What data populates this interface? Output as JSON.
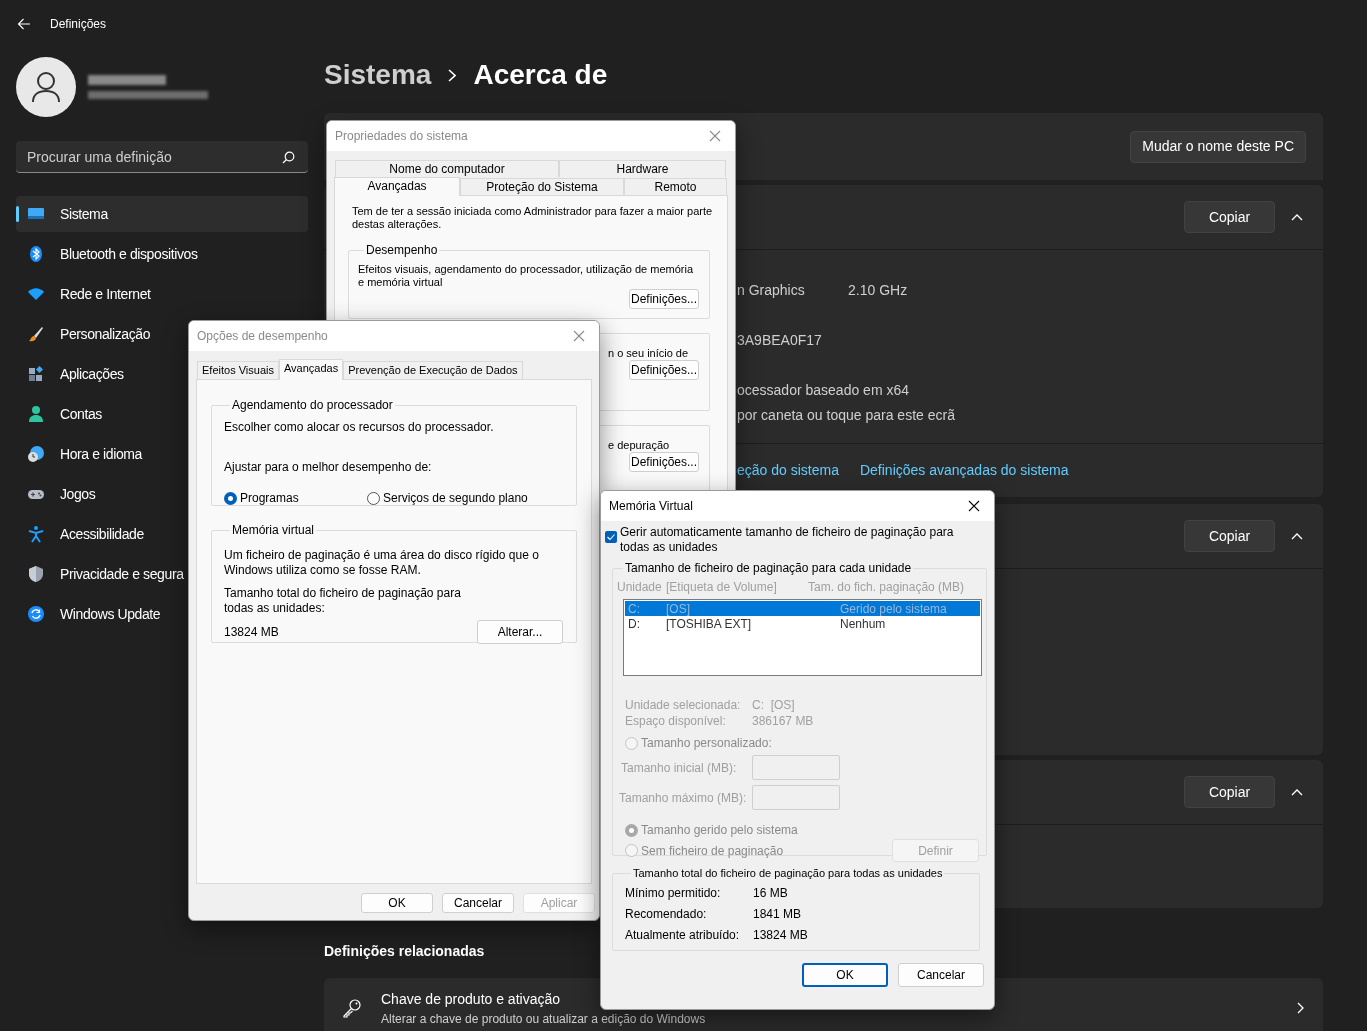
{
  "window": {
    "title": "Definições"
  },
  "sidebar": {
    "search": {
      "placeholder": "Procurar uma definição"
    },
    "items": [
      {
        "label": "Sistema",
        "selected": true
      },
      {
        "label": "Bluetooth e dispositivos",
        "selected": false
      },
      {
        "label": "Rede e Internet",
        "selected": false
      },
      {
        "label": "Personalização",
        "selected": false
      },
      {
        "label": "Aplicações",
        "selected": false
      },
      {
        "label": "Contas",
        "selected": false
      },
      {
        "label": "Hora e idioma",
        "selected": false
      },
      {
        "label": "Jogos",
        "selected": false
      },
      {
        "label": "Acessibilidade",
        "selected": false
      },
      {
        "label": "Privacidade e segura",
        "selected": false
      },
      {
        "label": "Windows Update",
        "selected": false
      }
    ]
  },
  "breadcrumb": {
    "parent": "Sistema",
    "current": "Acerca de"
  },
  "device_card": {
    "button": "Mudar o nome deste PC"
  },
  "specs_card": {
    "button": "Copiar",
    "expanded": true,
    "sections": [
      {
        "lines": [
          [
            "n Graphics",
            "2.10 GHz"
          ]
        ]
      },
      {
        "lines": [
          [
            "3A9BEA0F17"
          ]
        ]
      },
      {
        "lines": [
          [
            "ocessador baseado em x64"
          ],
          [
            "por caneta ou toque para este ecrã"
          ]
        ]
      }
    ],
    "links": [
      "eção do sistema",
      "Definições avançadas do sistema"
    ]
  },
  "windows_card": {
    "button": "Copiar",
    "expanded": true
  },
  "support_card": {
    "button": "Copiar",
    "expanded": true
  },
  "related": {
    "title": "Definições relacionadas",
    "items": [
      {
        "title": "Chave de produto e ativação",
        "subtitle": "Alterar a chave de produto ou atualizar a edição do Windows"
      }
    ]
  },
  "system_properties": {
    "title": "Propriedades do sistema",
    "tab_rows": [
      [
        {
          "label": "Nome do computador",
          "selected": false
        },
        {
          "label": "Hardware",
          "selected": false
        }
      ],
      [
        {
          "label": "Avançadas",
          "selected": true
        },
        {
          "label": "Proteção do Sistema",
          "selected": false
        },
        {
          "label": "Remoto",
          "selected": false
        }
      ]
    ],
    "note": "Tem de ter a sessão iniciada como Administrador para fazer a maior parte destas alterações.",
    "groups": [
      {
        "title": "Desempenho",
        "text": "Efeitos visuais, agendamento do processador, utilização de memória e memória virtual",
        "button": "Definições..."
      },
      {
        "text": "n o seu início de",
        "button": "Definições..."
      },
      {
        "text": "e depuração",
        "button": "Definições..."
      }
    ]
  },
  "performance_options": {
    "title": "Opções de desempenho",
    "tabs": [
      {
        "label": "Efeitos Visuais",
        "selected": false
      },
      {
        "label": "Avançadas",
        "selected": true
      },
      {
        "label": "Prevenção de Execução de Dados",
        "selected": false
      }
    ],
    "scheduling": {
      "title": "Agendamento do processador",
      "text": "Escolher como alocar os recursos do processador.",
      "prompt": "Ajustar para o melhor desempenho de:",
      "options": [
        {
          "label": "Programas",
          "selected": true
        },
        {
          "label": "Serviços de segundo plano",
          "selected": false
        }
      ]
    },
    "virtual_memory": {
      "title": "Memória virtual",
      "text": "Um ficheiro de paginação é uma área do disco rígido que o Windows utiliza como se fosse RAM.",
      "total_label": "Tamanho total do ficheiro de paginação para todas as unidades:",
      "total": "13824 MB",
      "button": "Alterar..."
    },
    "buttons": [
      {
        "label": "OK",
        "disabled": false
      },
      {
        "label": "Cancelar",
        "disabled": false
      },
      {
        "label": "Aplicar",
        "disabled": true
      }
    ]
  },
  "virtual_memory": {
    "title": "Memória Virtual",
    "auto_manage": {
      "label": "Gerir automaticamente tamanho de ficheiro de paginação para todas as unidades",
      "checked": true
    },
    "drives_group": {
      "title": "Tamanho de ficheiro de paginação para cada unidade",
      "disabled": true,
      "columns": [
        "Unidade",
        "[Etiqueta de Volume]",
        "Tam. do fich. paginação (MB)"
      ],
      "drives": [
        {
          "drive": "C:",
          "label": "[OS]",
          "size": "Gerido pelo sistema",
          "selected": true
        },
        {
          "drive": "D:",
          "label": "[TOSHIBA EXT]",
          "size": "Nenhum",
          "selected": false
        }
      ],
      "details": [
        {
          "label": "Unidade selecionada:",
          "value": "C:  [OS]"
        },
        {
          "label": "Espaço disponível:",
          "value": "386167 MB"
        }
      ],
      "custom": {
        "label": "Tamanho personalizado:",
        "selected": false
      },
      "fields": [
        {
          "label": "Tamanho inicial (MB):"
        },
        {
          "label": "Tamanho máximo (MB):"
        }
      ],
      "system_managed": {
        "label": "Tamanho gerido pelo sistema",
        "selected": true
      },
      "no_file": {
        "label": "Sem ficheiro de paginação",
        "selected": false
      },
      "button": "Definir"
    },
    "totals": {
      "title": "Tamanho total do ficheiro de paginação para todas as unidades",
      "rows": [
        {
          "label": "Mínimo permitido:",
          "value": "16 MB"
        },
        {
          "label": "Recomendado:",
          "value": "1841 MB"
        },
        {
          "label": "Atualmente atribuído:",
          "value": "13824 MB"
        }
      ]
    },
    "buttons": [
      {
        "label": "OK",
        "default": true
      },
      {
        "label": "Cancelar",
        "default": false
      }
    ]
  }
}
